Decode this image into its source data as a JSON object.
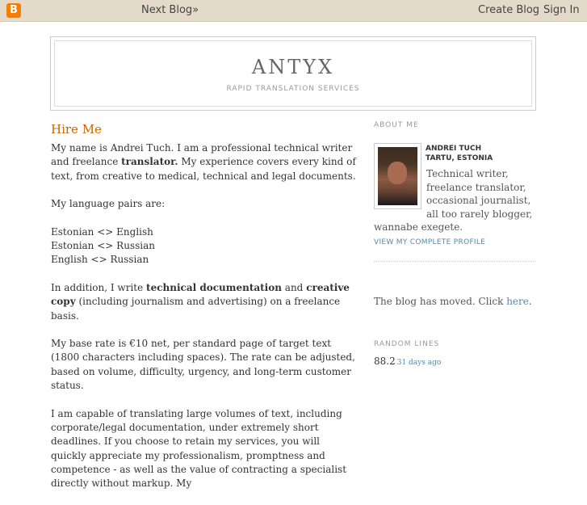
{
  "navbar": {
    "logo_letter": "B",
    "next_blog": "Next Blog»",
    "create_blog": "Create Blog",
    "sign_in": "Sign In"
  },
  "header": {
    "title": "ANTYX",
    "description": "RAPID TRANSLATION SERVICES"
  },
  "post": {
    "title": "Hire Me",
    "p1": {
      "a": "My name is Andrei Tuch. I am a professional technical writer and freelance ",
      "b": "translator.",
      "c": " My experience covers every kind of text, from creative to medical, technical and legal documents."
    },
    "p2": "My language pairs are:",
    "pairs": [
      "Estonian <> English",
      "Estonian <> Russian",
      "English <> Russian"
    ],
    "p4": {
      "a": "In addition, I write ",
      "b": "technical documentation",
      "c": " and ",
      "d": "creative copy",
      "e": " (including journalism and advertising) on a freelance basis."
    },
    "p5": "My base rate is €10 net, per standard page of target text (1800 characters including spaces). The rate can be adjusted, based on volume, difficulty, urgency, and long-term customer status.",
    "p6": "I am capable of translating large volumes of text, including corporate/legal documentation, under extremely short deadlines. If you choose to retain my services, you will quickly appreciate my professionalism, promptness and competence - as well as the value of contracting a specialist directly without markup. My"
  },
  "sidebar": {
    "about_heading": "ABOUT ME",
    "name": "ANDREI TUCH",
    "location": "TARTU, ESTONIA",
    "desc_lines": [
      "Technical writer,",
      "freelance translator,",
      "occasional journalist,",
      "all too rarely blogger,"
    ],
    "desc_last": "wannabe exegete.",
    "view_profile": "VIEW MY COMPLETE PROFILE",
    "moved_text": "The blog has moved. Click ",
    "moved_link": "here",
    "moved_end": ".",
    "random_heading": "RANDOM LINES",
    "random_value": "88.2",
    "random_ago": "31 days ago"
  }
}
